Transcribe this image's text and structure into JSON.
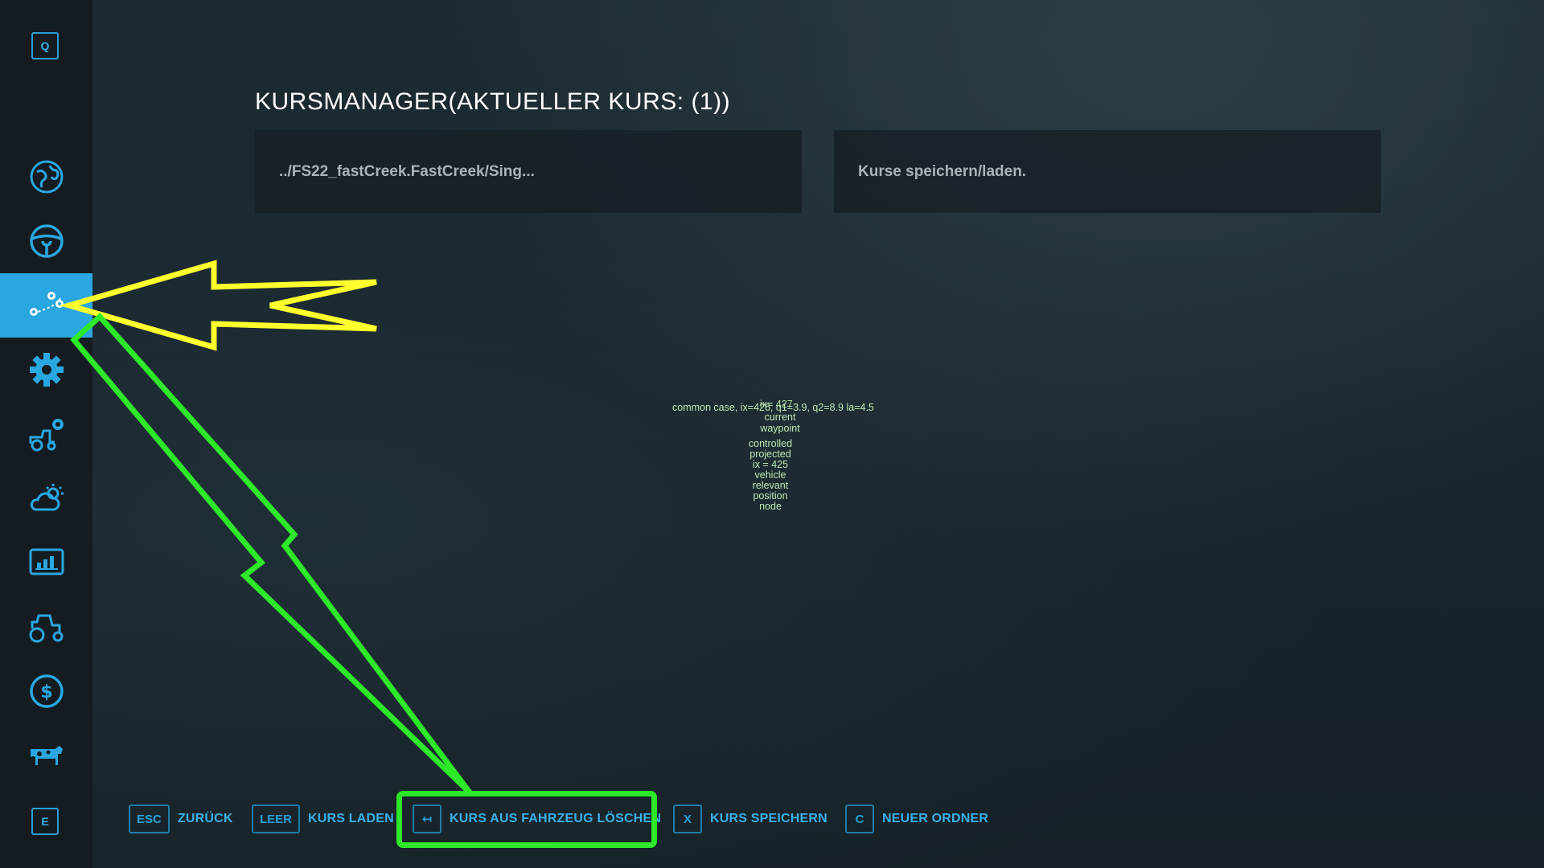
{
  "sidebar": {
    "top_key": "Q",
    "bottom_key": "E",
    "items": [
      {
        "icon": "map-icon"
      },
      {
        "icon": "steering-wheel-icon"
      },
      {
        "icon": "course-manager-icon",
        "active": true
      },
      {
        "icon": "settings-gear-icon"
      },
      {
        "icon": "vehicle-settings-icon"
      },
      {
        "icon": "weather-icon"
      },
      {
        "icon": "statistics-icon"
      },
      {
        "icon": "tractor-icon"
      },
      {
        "icon": "finances-icon"
      },
      {
        "icon": "animals-icon"
      }
    ]
  },
  "header": {
    "title": "KURSMANAGER(AKTUELLER KURS:  (1))"
  },
  "panels": {
    "path": "../FS22_fastCreek.FastCreek/Sing...",
    "info": "Kurse speichern/laden."
  },
  "debug_overlay": {
    "line1": "common case, ix=426, q1=3.9, q2=8.9 la=4.5",
    "line1b": "ix= 427",
    "current_waypoint_1": "current",
    "current_waypoint_2": "waypoint",
    "controlled_1": "controlled",
    "controlled_2": "projected",
    "controlled_3": "ix = 425",
    "controlled_4": "vehicle",
    "controlled_5": "relevant",
    "controlled_6": "position",
    "controlled_7": "node"
  },
  "footer": [
    {
      "key": "ESC",
      "label": "ZURÜCK"
    },
    {
      "key": "LEER",
      "label": "KURS LADEN"
    },
    {
      "key": "↤",
      "label": "KURS AUS FAHRZEUG LÖSCHEN"
    },
    {
      "key": "X",
      "label": "KURS SPEICHERN"
    },
    {
      "key": "C",
      "label": "NEUER ORDNER"
    }
  ],
  "colors": {
    "accent": "#2aa7e0",
    "yellow_arrow": "#ffff2e",
    "green_arrow": "#2ee82a"
  }
}
